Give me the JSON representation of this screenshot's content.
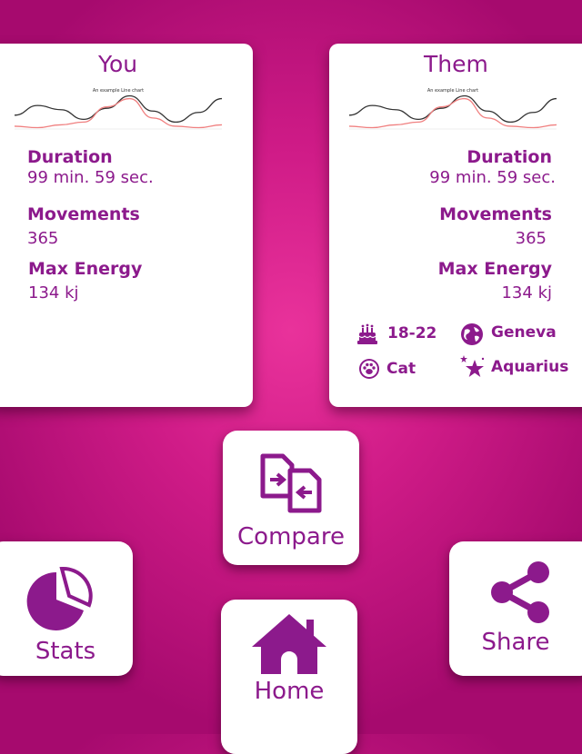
{
  "colors": {
    "accent": "#8c1a8c",
    "background": "#cf1b87",
    "card": "#ffffff"
  },
  "you": {
    "title": "You",
    "chart": {
      "title": "An example Line chart",
      "series": [
        {
          "color": "#333333",
          "values": [
            20,
            34,
            28,
            14,
            30,
            48,
            26,
            10,
            24,
            44
          ]
        },
        {
          "color": "#f08080",
          "values": [
            4,
            2,
            6,
            10,
            32,
            44,
            16,
            4,
            2,
            6
          ]
        }
      ]
    },
    "duration_label": "Duration",
    "duration_value": "99 min. 59 sec.",
    "movements_label": "Movements",
    "movements_value": "365",
    "max_energy_label": "Max Energy",
    "max_energy_value": "134 kj"
  },
  "them": {
    "title": "Them",
    "chart": {
      "title": "An example Line chart",
      "series": [
        {
          "color": "#333333",
          "values": [
            20,
            34,
            28,
            14,
            30,
            48,
            26,
            10,
            24,
            44
          ]
        },
        {
          "color": "#f08080",
          "values": [
            4,
            2,
            6,
            10,
            32,
            44,
            16,
            4,
            2,
            6
          ]
        }
      ]
    },
    "duration_label": "Duration",
    "duration_value": "99 min. 59 sec.",
    "movements_label": "Movements",
    "movements_value": "365",
    "max_energy_label": "Max Energy",
    "max_energy_value": "134 kj",
    "age": "18-22",
    "city": "Geneva",
    "pet": "Cat",
    "sign": "Aquarius"
  },
  "buttons": {
    "compare": "Compare",
    "stats": "Stats",
    "share": "Share",
    "home": "Home"
  },
  "icons": {
    "age": "cake-icon",
    "city": "globe-icon",
    "pet": "paw-icon",
    "sign": "stars-icon",
    "compare": "compare-files-icon",
    "stats": "pie-chart-icon",
    "share": "share-icon",
    "home": "home-icon"
  }
}
